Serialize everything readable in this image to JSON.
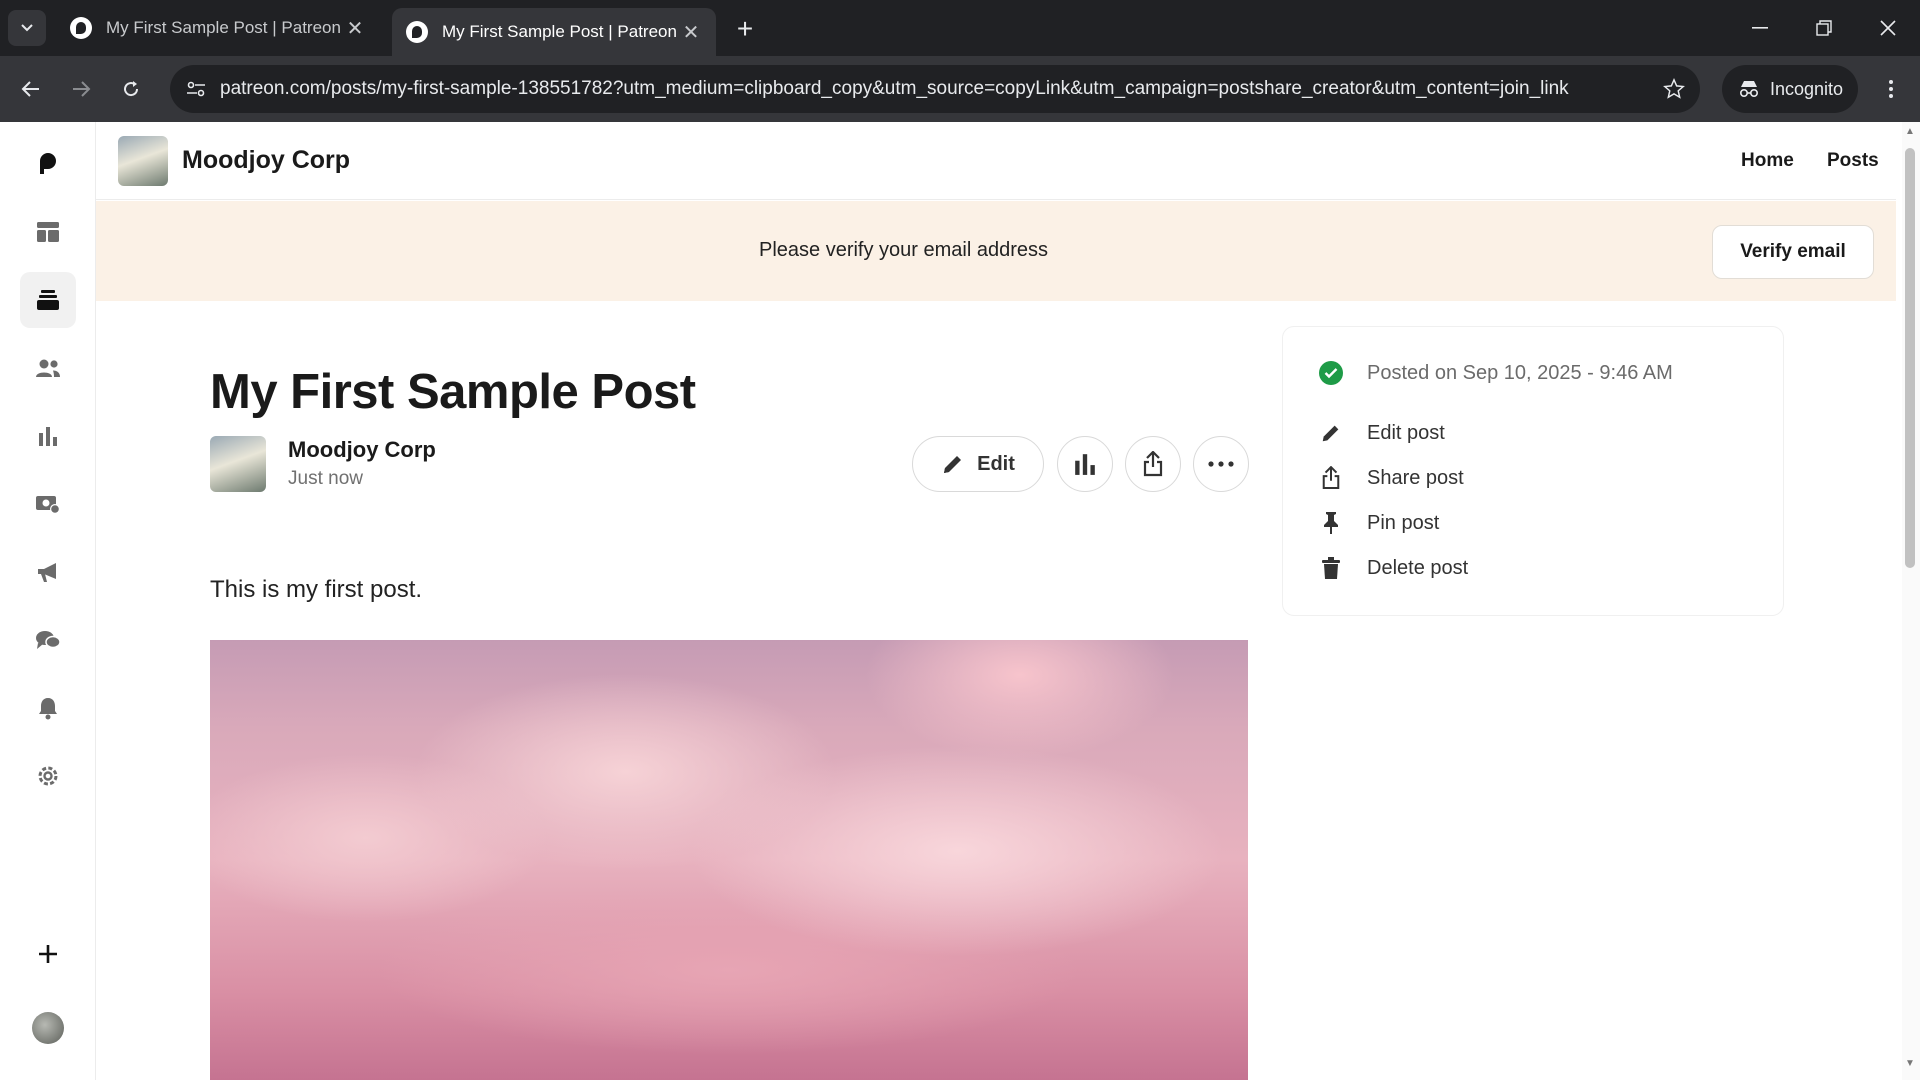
{
  "browser": {
    "tabs": [
      {
        "title": "My First Sample Post | Patreon",
        "active": false
      },
      {
        "title": "My First Sample Post | Patreon",
        "active": true
      }
    ],
    "url": "patreon.com/posts/my-first-sample-138551782?utm_medium=clipboard_copy&utm_source=copyLink&utm_campaign=postshare_creator&utm_content=join_link",
    "profile_label": "Incognito"
  },
  "header": {
    "creator_name": "Moodjoy Corp",
    "nav": [
      "Home",
      "Posts"
    ]
  },
  "banner": {
    "message": "Please verify your email address",
    "button": "Verify email"
  },
  "post": {
    "title": "My First Sample Post",
    "author": "Moodjoy Corp",
    "time": "Just now",
    "edit_label": "Edit",
    "body": "This is my first post."
  },
  "side_panel": {
    "posted": "Posted on Sep 10, 2025 - 9:46 AM",
    "actions": [
      {
        "label": "Edit post",
        "icon": "pencil-icon"
      },
      {
        "label": "Share post",
        "icon": "share-icon"
      },
      {
        "label": "Pin post",
        "icon": "pin-icon"
      },
      {
        "label": "Delete post",
        "icon": "trash-icon"
      }
    ]
  },
  "rail_icons": [
    "patreon-logo-icon",
    "dashboard-icon",
    "library-icon",
    "audience-icon",
    "insights-icon",
    "payouts-icon",
    "promotions-icon",
    "chats-icon",
    "notifications-icon",
    "settings-icon",
    "create-icon"
  ],
  "colors": {
    "success": "#1e9b47",
    "banner_bg": "#fbf1e6",
    "chrome_dark": "#202124"
  }
}
